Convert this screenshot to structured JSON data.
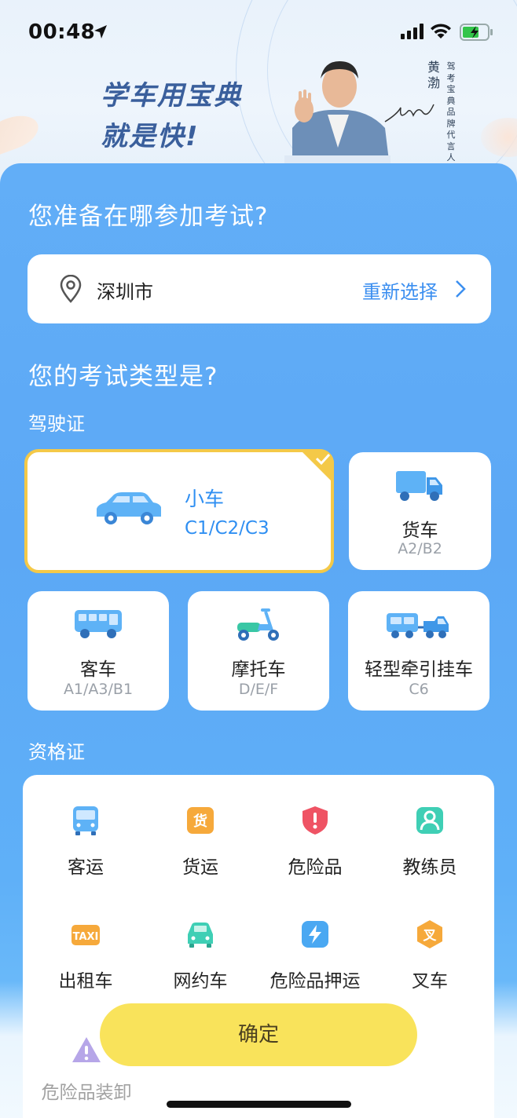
{
  "status_bar": {
    "time": "00:48",
    "icons": [
      "location-arrow-icon",
      "signal-icon",
      "wifi-icon",
      "battery-charging-icon"
    ]
  },
  "banner": {
    "slogan_line1": "学车用宝典",
    "slogan_line2": "就是快!",
    "ambassador_name": "黄渤",
    "ambassador_title": "驾考宝典品牌代言人"
  },
  "location": {
    "question": "您准备在哪参加考试?",
    "city": "深圳市",
    "reselect_label": "重新选择"
  },
  "exam_type": {
    "question": "您的考试类型是?",
    "license_section": "驾驶证",
    "licenses": [
      {
        "label": "小车",
        "sub": "C1/C2/C3",
        "icon": "car-icon",
        "selected": true
      },
      {
        "label": "货车",
        "sub": "A2/B2",
        "icon": "truck-icon",
        "selected": false
      },
      {
        "label": "客车",
        "sub": "A1/A3/B1",
        "icon": "bus-icon",
        "selected": false
      },
      {
        "label": "摩托车",
        "sub": "D/E/F",
        "icon": "scooter-icon",
        "selected": false
      },
      {
        "label": "轻型牵引挂车",
        "sub": "C6",
        "icon": "trailer-icon",
        "selected": false
      }
    ],
    "qualification_section": "资格证",
    "qualifications": [
      {
        "label": "客运",
        "icon": "bus-front-icon"
      },
      {
        "label": "货运",
        "icon": "cargo-icon"
      },
      {
        "label": "危险品",
        "icon": "hazard-shield-icon"
      },
      {
        "label": "教练员",
        "icon": "coach-icon"
      },
      {
        "label": "出租车",
        "icon": "taxi-icon"
      },
      {
        "label": "网约车",
        "icon": "ride-hailing-car-icon"
      },
      {
        "label": "危险品押运",
        "icon": "escort-bolt-icon"
      },
      {
        "label": "叉车",
        "icon": "forklift-icon"
      },
      {
        "label": "危险品装卸",
        "icon": "warning-triangle-icon"
      }
    ]
  },
  "confirm_label": "确定",
  "colors": {
    "panel_blue": "#5ca8f5",
    "accent_blue": "#3c8ff0",
    "selected_border": "#f4c948",
    "confirm_yellow": "#f9e35b"
  }
}
